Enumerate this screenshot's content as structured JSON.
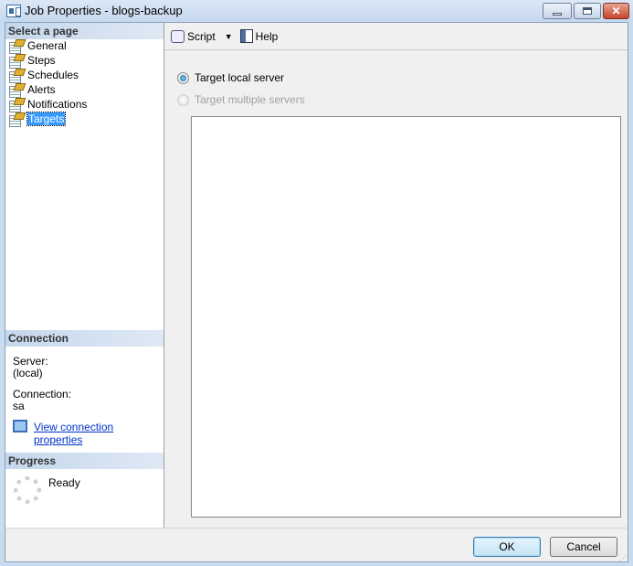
{
  "window": {
    "title": "Job Properties - blogs-backup"
  },
  "sidebar": {
    "select_page_header": "Select a page",
    "pages": [
      {
        "label": "General"
      },
      {
        "label": "Steps"
      },
      {
        "label": "Schedules"
      },
      {
        "label": "Alerts"
      },
      {
        "label": "Notifications"
      },
      {
        "label": "Targets"
      }
    ],
    "selected": "Targets",
    "connection": {
      "header": "Connection",
      "server_label": "Server:",
      "server_value": "(local)",
      "connection_label": "Connection:",
      "connection_value": "sa",
      "view_link": "View connection properties"
    },
    "progress": {
      "header": "Progress",
      "status": "Ready"
    }
  },
  "toolbar": {
    "script_label": "Script",
    "help_label": "Help"
  },
  "main": {
    "radio_local": "Target local server",
    "radio_multiple": "Target multiple servers",
    "selected": "local"
  },
  "footer": {
    "ok_label": "OK",
    "cancel_label": "Cancel"
  }
}
